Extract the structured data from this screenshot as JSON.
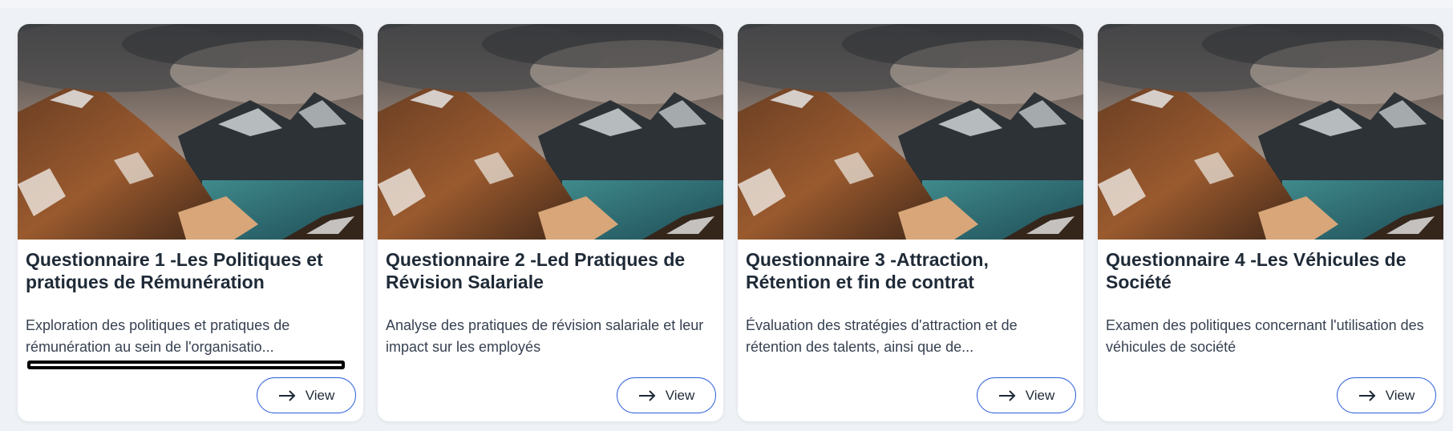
{
  "colors": {
    "page_background": "#eef1f5",
    "card_background": "#ffffff",
    "button_border": "#2b5fd9",
    "title_text": "#1f2a37"
  },
  "cards": [
    {
      "image_icon": "mountain-landscape-image",
      "title": "Questionnaire 1 -Les Politiques et pratiques de Rémunération",
      "description": "Exploration des politiques et pratiques de rémunération au sein de l'organisatio...",
      "button_label": "View",
      "button_icon": "arrow-right-icon"
    },
    {
      "image_icon": "mountain-landscape-image",
      "title": "Questionnaire 2 -Led Pratiques de Révision Salariale",
      "description": "Analyse des pratiques de révision salariale et leur impact sur les employés",
      "button_label": "View",
      "button_icon": "arrow-right-icon"
    },
    {
      "image_icon": "mountain-landscape-image",
      "title": "Questionnaire 3 -Attraction, Rétention et fin de contrat",
      "description": "Évaluation des stratégies d'attraction et de rétention des talents, ainsi que de...",
      "button_label": "View",
      "button_icon": "arrow-right-icon"
    },
    {
      "image_icon": "mountain-landscape-image",
      "title": "Questionnaire 4 -Les Véhicules de Société",
      "description": "Examen des politiques concernant l'utilisation des véhicules de société",
      "button_label": "View",
      "button_icon": "arrow-right-icon"
    }
  ]
}
